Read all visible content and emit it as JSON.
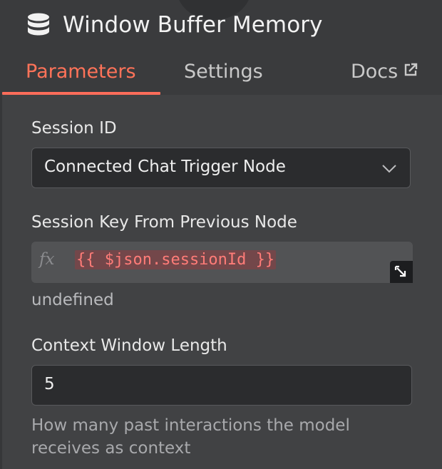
{
  "header": {
    "title": "Window Buffer Memory",
    "icon": "database-icon"
  },
  "tabs": [
    {
      "label": "Parameters",
      "active": true
    },
    {
      "label": "Settings",
      "active": false
    },
    {
      "label": "Docs",
      "active": false,
      "icon": "external-link-icon"
    }
  ],
  "fields": {
    "session_id": {
      "label": "Session ID",
      "value": "Connected Chat Trigger Node"
    },
    "session_key": {
      "label": "Session Key From Previous Node",
      "fx": "fx",
      "expression": "{{ $json.sessionId }}",
      "result": "undefined"
    },
    "context_window": {
      "label": "Context Window Length",
      "value": "5",
      "hint": "How many past interactions the model receives as context"
    }
  },
  "colors": {
    "accent": "#ff6d5a",
    "background": "#414244",
    "header_bg": "#3a3b3d",
    "input_bg": "#2b2c2e",
    "expression_bg": "#525355"
  }
}
